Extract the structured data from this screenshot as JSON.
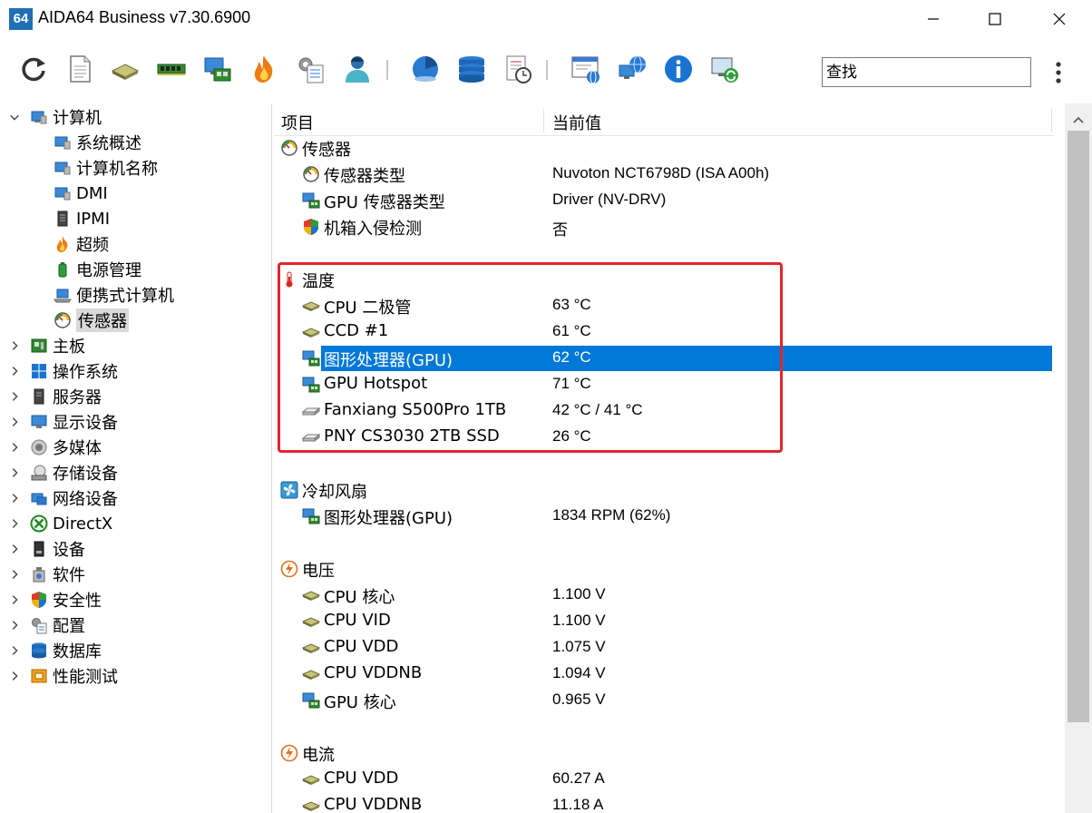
{
  "window": {
    "app_icon_text": "64",
    "title": "AIDA64 Business v7.30.6900"
  },
  "toolbar": {
    "search_placeholder": "查找"
  },
  "tree": {
    "items": [
      {
        "label": "计算机"
      },
      {
        "label": "系统概述"
      },
      {
        "label": "计算机名称"
      },
      {
        "label": "DMI"
      },
      {
        "label": "IPMI"
      },
      {
        "label": "超频"
      },
      {
        "label": "电源管理"
      },
      {
        "label": "便携式计算机"
      },
      {
        "label": "传感器"
      },
      {
        "label": "主板"
      },
      {
        "label": "操作系统"
      },
      {
        "label": "服务器"
      },
      {
        "label": "显示设备"
      },
      {
        "label": "多媒体"
      },
      {
        "label": "存储设备"
      },
      {
        "label": "网络设备"
      },
      {
        "label": "DirectX"
      },
      {
        "label": "设备"
      },
      {
        "label": "软件"
      },
      {
        "label": "安全性"
      },
      {
        "label": "配置"
      },
      {
        "label": "数据库"
      },
      {
        "label": "性能测试"
      }
    ]
  },
  "list": {
    "headers": {
      "item": "项目",
      "value": "当前值"
    },
    "rows": [
      {
        "name": "传感器",
        "value": ""
      },
      {
        "name": "传感器类型",
        "value": "Nuvoton NCT6798D  (ISA A00h)"
      },
      {
        "name": "GPU 传感器类型",
        "value": "Driver  (NV-DRV)"
      },
      {
        "name": "机箱入侵检测",
        "value": "否"
      },
      {
        "name": "温度",
        "value": ""
      },
      {
        "name": "CPU 二极管",
        "value": "63 °C"
      },
      {
        "name": "CCD #1",
        "value": "61 °C"
      },
      {
        "name": "图形处理器(GPU)",
        "value": "62 °C"
      },
      {
        "name": "GPU Hotspot",
        "value": "71 °C"
      },
      {
        "name": "Fanxiang S500Pro 1TB",
        "value": "42 °C / 41 °C"
      },
      {
        "name": "PNY CS3030 2TB SSD",
        "value": "26 °C"
      },
      {
        "name": "冷却风扇",
        "value": ""
      },
      {
        "name": "图形处理器(GPU)",
        "value": "1834 RPM  (62%)"
      },
      {
        "name": "电压",
        "value": ""
      },
      {
        "name": "CPU 核心",
        "value": "1.100 V"
      },
      {
        "name": "CPU VID",
        "value": "1.100 V"
      },
      {
        "name": "CPU VDD",
        "value": "1.075 V"
      },
      {
        "name": "CPU VDDNB",
        "value": "1.094 V"
      },
      {
        "name": "GPU 核心",
        "value": "0.965 V"
      },
      {
        "name": "电流",
        "value": ""
      },
      {
        "name": "CPU VDD",
        "value": "60.27 A"
      },
      {
        "name": "CPU VDDNB",
        "value": "11.18 A"
      }
    ]
  },
  "colors": {
    "selection": "#0078d7",
    "annotation_box": "#e0262a",
    "tree_selected": "#d9d9d9"
  }
}
